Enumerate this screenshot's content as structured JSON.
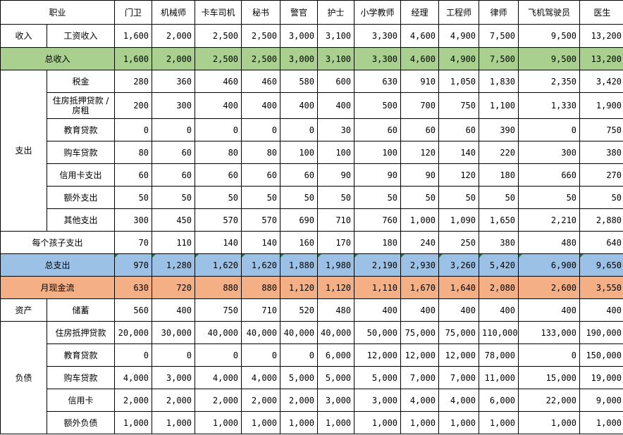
{
  "header": {
    "occupation_label": "职业",
    "columns": [
      "门卫",
      "机械师",
      "卡车司机",
      "秘书",
      "警官",
      "护士",
      "小学教师",
      "经理",
      "工程师",
      "律师",
      "飞机驾驶员",
      "医生"
    ]
  },
  "groups": {
    "income": "收入",
    "expense": "支出",
    "assets": "资产",
    "liabilities": "负债"
  },
  "rows": {
    "salary": {
      "label": "工资收入",
      "values": [
        "1,600",
        "2,000",
        "2,500",
        "2,500",
        "3,000",
        "3,100",
        "3,300",
        "4,600",
        "4,900",
        "7,500",
        "9,500",
        "13,200"
      ]
    },
    "total_income": {
      "label": "总收入",
      "values": [
        "1,600",
        "2,000",
        "2,500",
        "2,500",
        "3,000",
        "3,100",
        "3,300",
        "4,600",
        "4,900",
        "7,500",
        "9,500",
        "13,200"
      ]
    },
    "tax": {
      "label": "税金",
      "values": [
        "280",
        "360",
        "460",
        "460",
        "580",
        "600",
        "630",
        "910",
        "1,050",
        "1,830",
        "2,350",
        "3,420"
      ]
    },
    "mortgage": {
      "label": "住房抵押贷款 / 房租",
      "values": [
        "200",
        "300",
        "400",
        "400",
        "400",
        "400",
        "500",
        "700",
        "750",
        "1,100",
        "1,330",
        "1,900"
      ]
    },
    "edu_loan": {
      "label": "教育贷款",
      "values": [
        "0",
        "0",
        "0",
        "0",
        "0",
        "30",
        "60",
        "60",
        "60",
        "390",
        "0",
        "750"
      ]
    },
    "car_loan": {
      "label": "购车贷款",
      "values": [
        "80",
        "60",
        "80",
        "80",
        "100",
        "100",
        "100",
        "120",
        "140",
        "220",
        "300",
        "380"
      ]
    },
    "credit": {
      "label": "信用卡支出",
      "values": [
        "60",
        "60",
        "60",
        "60",
        "60",
        "90",
        "90",
        "90",
        "120",
        "180",
        "660",
        "270"
      ]
    },
    "extra": {
      "label": "额外支出",
      "values": [
        "50",
        "50",
        "50",
        "50",
        "50",
        "50",
        "50",
        "50",
        "50",
        "50",
        "50",
        "50"
      ]
    },
    "other": {
      "label": "其他支出",
      "values": [
        "300",
        "450",
        "570",
        "570",
        "690",
        "710",
        "760",
        "1,000",
        "1,090",
        "1,650",
        "2,210",
        "2,880"
      ]
    },
    "child": {
      "label": "每个孩子支出",
      "values": [
        "70",
        "110",
        "140",
        "140",
        "160",
        "170",
        "180",
        "240",
        "250",
        "380",
        "480",
        "640"
      ]
    },
    "total_expense": {
      "label": "总支出",
      "values": [
        "970",
        "1,280",
        "1,620",
        "1,620",
        "1,880",
        "1,980",
        "2,190",
        "2,930",
        "3,260",
        "5,420",
        "6,900",
        "9,650"
      ]
    },
    "cashflow": {
      "label": "月现金流",
      "values": [
        "630",
        "720",
        "880",
        "880",
        "1,120",
        "1,120",
        "1,110",
        "1,670",
        "1,640",
        "2,080",
        "2,600",
        "3,550"
      ]
    },
    "savings": {
      "label": "储蓄",
      "values": [
        "560",
        "400",
        "750",
        "710",
        "520",
        "480",
        "400",
        "400",
        "400",
        "400",
        "400",
        "400"
      ]
    },
    "liab_mortgage": {
      "label": "住房抵押贷款",
      "values": [
        "20,000",
        "30,000",
        "40,000",
        "40,000",
        "40,000",
        "40,000",
        "50,000",
        "75,000",
        "75,000",
        "110,000",
        "133,000",
        "190,000"
      ]
    },
    "liab_edu": {
      "label": "教育贷款",
      "values": [
        "0",
        "0",
        "0",
        "0",
        "0",
        "6,000",
        "12,000",
        "12,000",
        "12,000",
        "78,000",
        "0",
        "150,000"
      ]
    },
    "liab_car": {
      "label": "购车贷款",
      "values": [
        "4,000",
        "3,000",
        "4,000",
        "4,000",
        "5,000",
        "5,000",
        "5,000",
        "7,000",
        "7,000",
        "11,000",
        "15,000",
        "19,000"
      ]
    },
    "liab_credit": {
      "label": "信用卡",
      "values": [
        "2,000",
        "2,000",
        "2,000",
        "2,000",
        "2,000",
        "3,000",
        "3,000",
        "4,000",
        "4,000",
        "6,000",
        "22,000",
        "9,000"
      ]
    },
    "liab_extra": {
      "label": "额外负债",
      "values": [
        "1,000",
        "1,000",
        "1,000",
        "1,000",
        "1,000",
        "1,000",
        "1,000",
        "1,000",
        "1,000",
        "1,000",
        "1,000",
        "1,000"
      ]
    }
  },
  "colors": {
    "total_income_bg": "#a9d08e",
    "total_expense_bg": "#9bc2e6",
    "cashflow_bg": "#f4b084"
  }
}
